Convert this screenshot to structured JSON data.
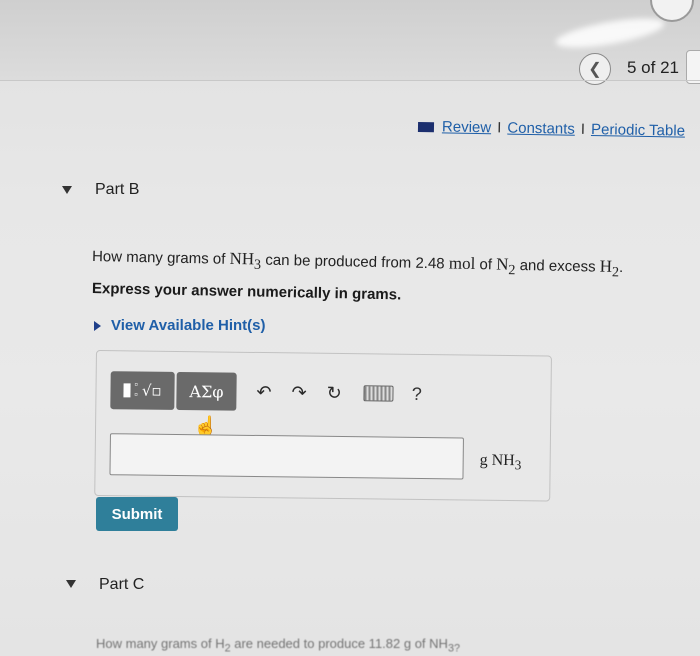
{
  "pager": {
    "text": "5 of 21",
    "prev_icon": "chevron-left-icon"
  },
  "links": {
    "review": "Review",
    "constants": "Constants",
    "periodic_table": "Periodic Table",
    "separator": "I"
  },
  "part_b": {
    "label": "Part B",
    "question": {
      "prefix": "How many grams of ",
      "nh3": "NH",
      "nh3_sub": "3",
      "mid": " can be produced from ",
      "amount": "2.48",
      "mol": " mol",
      "mid2": " of ",
      "n2": "N",
      "n2_sub": "2",
      "mid3": " and excess ",
      "h2": "H",
      "h2_sub": "2",
      "end": "."
    },
    "instruction": "Express your answer numerically in grams.",
    "hint_link": "View Available Hint(s)",
    "toolbar": {
      "greek": "ΑΣφ",
      "help": "?"
    },
    "answer": {
      "value": "",
      "placeholder": ""
    },
    "unit": {
      "g": "g ",
      "nh": "NH",
      "sub": "3"
    },
    "submit": "Submit"
  },
  "part_c": {
    "label": "Part C",
    "question_partial": "How many grams of H",
    "question_partial_sub": "2",
    "question_partial_rest": " are needed to produce 11.82 g of NH",
    "question_partial_end": "3?"
  },
  "colors": {
    "link_blue": "#1f5fa8",
    "submit_teal": "#2f7f9a",
    "toolbar_gray": "#6a6a6a"
  }
}
